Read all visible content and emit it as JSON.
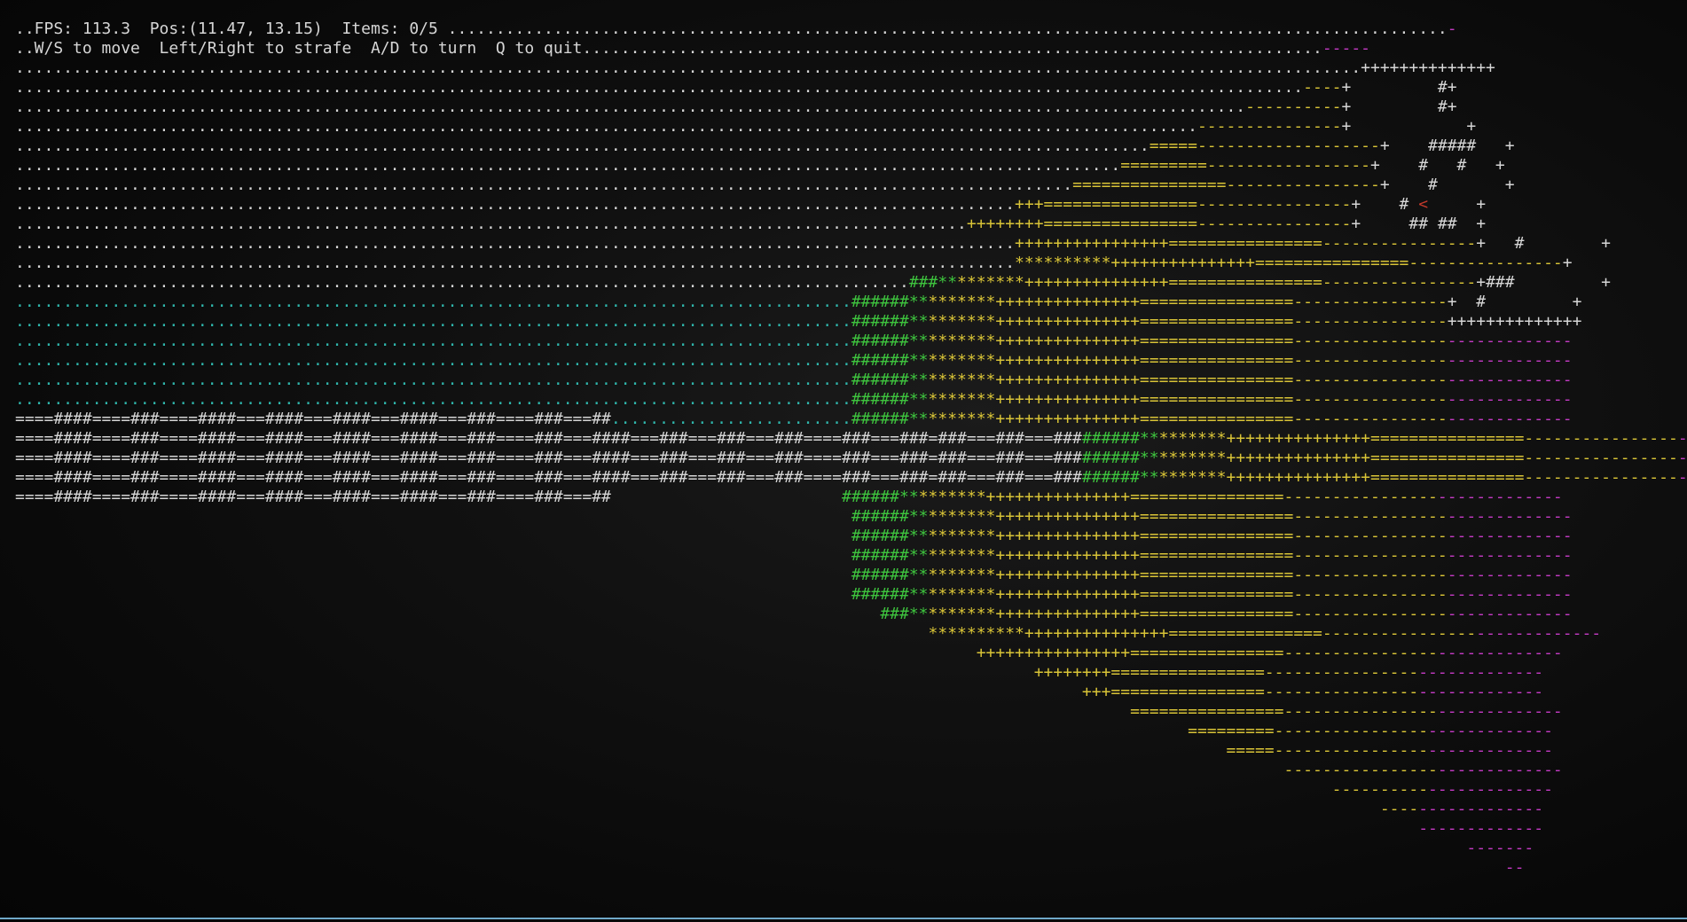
{
  "hud": {
    "status_line": "..FPS: 113.3  Pos:(11.47, 13.15)  Items: 0/5",
    "fps": "113.3",
    "position": "(11.47, 13.15)",
    "items": "0/5",
    "help_line": "..W/S to move  Left/Right to strafe  A/D to turn  Q to quit"
  },
  "palette": {
    "w": "#d6d6d6",
    "c": "#2fb7ad",
    "g": "#3ec43e",
    "y": "#d9c437",
    "m": "#c23ac2",
    "r": "#c0392b"
  },
  "screen_rows": [
    [
      [
        "w",
        "..FPS: 113.3  Pos:(11.47, 13.15)  Items: 0/5 ........................................................................................................"
      ],
      [
        "m",
        "-"
      ]
    ],
    [
      [
        "w",
        "..W/S to move  Left/Right to strafe  A/D to turn  Q to quit............................................................................."
      ],
      [
        "m",
        "-----"
      ]
    ],
    [
      [
        "w",
        "............................................................................................................................................++++++++++++++"
      ]
    ],
    [
      [
        "w",
        "......................................................................................................................................"
      ],
      [
        "y",
        "----"
      ],
      [
        "w",
        "+         #+"
      ]
    ],
    [
      [
        "w",
        "................................................................................................................................"
      ],
      [
        "y",
        "----------"
      ],
      [
        "w",
        "+         #+"
      ]
    ],
    [
      [
        "w",
        "..........................................................................................................................."
      ],
      [
        "y",
        "---------------"
      ],
      [
        "w",
        "+            +"
      ]
    ],
    [
      [
        "w",
        "......................................................................................................................"
      ],
      [
        "y",
        "=====-------------------"
      ],
      [
        "w",
        "+    #####   +"
      ]
    ],
    [
      [
        "w",
        "..................................................................................................................."
      ],
      [
        "y",
        "=========-----------------"
      ],
      [
        "w",
        "+    #   #   +"
      ]
    ],
    [
      [
        "w",
        ".............................................................................................................."
      ],
      [
        "y",
        "================----------------"
      ],
      [
        "w",
        "+    #       +"
      ]
    ],
    [
      [
        "w",
        "........................................................................................................"
      ],
      [
        "y",
        "+++================----------------"
      ],
      [
        "w",
        "+    # "
      ],
      [
        "r",
        "<"
      ],
      [
        "w",
        "     +"
      ]
    ],
    [
      [
        "w",
        "..................................................................................................."
      ],
      [
        "y",
        "++++++++================----------------"
      ],
      [
        "w",
        "+     ## ##  +"
      ]
    ],
    [
      [
        "w",
        "........................................................................................................"
      ],
      [
        "y",
        "++++++++++++++++================----------------"
      ],
      [
        "w",
        "+   #        +"
      ]
    ],
    [
      [
        "w",
        "........................................................................................................"
      ],
      [
        "y",
        "**********+++++++++++++++================----------------"
      ],
      [
        "w",
        "+            +"
      ]
    ],
    [
      [
        "w",
        "............................................................................................."
      ],
      [
        "g",
        "###**"
      ],
      [
        "y",
        "*******+++++++++++++++================----------------"
      ],
      [
        "w",
        "+###         +"
      ]
    ],
    [
      [
        "c",
        "......................................................................................."
      ],
      [
        "g",
        "######**"
      ],
      [
        "y",
        "*******+++++++++++++++================----------------"
      ],
      [
        "w",
        "+  #         +"
      ]
    ],
    [
      [
        "c",
        "......................................................................................."
      ],
      [
        "g",
        "######**"
      ],
      [
        "y",
        "*******+++++++++++++++================----------------"
      ],
      [
        "w",
        "++++++++++++++"
      ]
    ],
    [
      [
        "c",
        "......................................................................................."
      ],
      [
        "g",
        "######**"
      ],
      [
        "y",
        "*******+++++++++++++++================----------------"
      ],
      [
        "m",
        "-------------"
      ]
    ],
    [
      [
        "c",
        "......................................................................................."
      ],
      [
        "g",
        "######**"
      ],
      [
        "y",
        "*******+++++++++++++++================----------------"
      ],
      [
        "m",
        "-------------"
      ]
    ],
    [
      [
        "c",
        "......................................................................................."
      ],
      [
        "g",
        "######**"
      ],
      [
        "y",
        "*******+++++++++++++++================----------------"
      ],
      [
        "m",
        "-------------"
      ]
    ],
    [
      [
        "c",
        "......................................................................................."
      ],
      [
        "g",
        "######**"
      ],
      [
        "y",
        "*******+++++++++++++++================----------------"
      ],
      [
        "m",
        "-------------"
      ]
    ],
    [
      [
        "w",
        "====####====###====####===####===####===####===###====###===##"
      ],
      [
        "c",
        "........................."
      ],
      [
        "g",
        "######**"
      ],
      [
        "y",
        "*******+++++++++++++++================----------------"
      ],
      [
        "m",
        "-------------"
      ]
    ],
    [
      [
        "w",
        "====####====###====####===####===####===####===###====###===####===###===###===###====###===###=###===###===###"
      ],
      [
        "g",
        "######**"
      ],
      [
        "y",
        "*******+++++++++++++++================----------------"
      ],
      [
        "m",
        "-------------"
      ]
    ],
    [
      [
        "w",
        "====####====###====####===####===####===####===###====###===####===###===###===###====###===###=###===###===###"
      ],
      [
        "g",
        "######**"
      ],
      [
        "y",
        "*******+++++++++++++++================----------------"
      ],
      [
        "m",
        "-------------"
      ]
    ],
    [
      [
        "w",
        "====####====###====####===####===####===####===###====###===####===###===###===###====###===###=###===###===###"
      ],
      [
        "g",
        "######**"
      ],
      [
        "y",
        "*******+++++++++++++++================----------------"
      ],
      [
        "m",
        "-------------"
      ]
    ],
    [
      [
        "w",
        "====####====###====####===####===####===####===###====###===##                        "
      ],
      [
        "g",
        "######**"
      ],
      [
        "y",
        "*******+++++++++++++++================----------------"
      ],
      [
        "m",
        "-------------"
      ]
    ],
    [
      [
        "w",
        "                                                                                       "
      ],
      [
        "g",
        "######**"
      ],
      [
        "y",
        "*******+++++++++++++++================----------------"
      ],
      [
        "m",
        "-------------"
      ]
    ],
    [
      [
        "w",
        "                                                                                       "
      ],
      [
        "g",
        "######**"
      ],
      [
        "y",
        "*******+++++++++++++++================----------------"
      ],
      [
        "m",
        "-------------"
      ]
    ],
    [
      [
        "w",
        "                                                                                       "
      ],
      [
        "g",
        "######**"
      ],
      [
        "y",
        "*******+++++++++++++++================----------------"
      ],
      [
        "m",
        "-------------"
      ]
    ],
    [
      [
        "w",
        "                                                                                       "
      ],
      [
        "g",
        "######**"
      ],
      [
        "y",
        "*******+++++++++++++++================----------------"
      ],
      [
        "m",
        "-------------"
      ]
    ],
    [
      [
        "w",
        "                                                                                       "
      ],
      [
        "g",
        "######**"
      ],
      [
        "y",
        "*******+++++++++++++++================----------------"
      ],
      [
        "m",
        "-------------"
      ]
    ],
    [
      [
        "w",
        "                                                                                          "
      ],
      [
        "g",
        "###**"
      ],
      [
        "y",
        "*******+++++++++++++++================----------------"
      ],
      [
        "m",
        "-------------"
      ]
    ],
    [
      [
        "w",
        "                                                                                               "
      ],
      [
        "y",
        "**********+++++++++++++++================----------------"
      ],
      [
        "m",
        "-------------"
      ]
    ],
    [
      [
        "w",
        "                                                                                                    "
      ],
      [
        "y",
        "++++++++++++++++================----------------"
      ],
      [
        "m",
        "-------------"
      ]
    ],
    [
      [
        "w",
        "                                                                                                          "
      ],
      [
        "y",
        "++++++++================----------------"
      ],
      [
        "m",
        "-------------"
      ]
    ],
    [
      [
        "w",
        "                                                                                                               "
      ],
      [
        "y",
        "+++================----------------"
      ],
      [
        "m",
        "-------------"
      ]
    ],
    [
      [
        "w",
        "                                                                                                                    "
      ],
      [
        "y",
        "================----------------"
      ],
      [
        "m",
        "-------------"
      ]
    ],
    [
      [
        "w",
        "                                                                                                                          "
      ],
      [
        "y",
        "=========----------------"
      ],
      [
        "m",
        "-------------"
      ]
    ],
    [
      [
        "w",
        "                                                                                                                              "
      ],
      [
        "y",
        "=====----------------"
      ],
      [
        "m",
        "-------------"
      ]
    ],
    [
      [
        "w",
        "                                                                                                                                    "
      ],
      [
        "y",
        "----------------"
      ],
      [
        "m",
        "-------------"
      ]
    ],
    [
      [
        "w",
        "                                                                                                                                         "
      ],
      [
        "y",
        "----------"
      ],
      [
        "m",
        "-------------"
      ]
    ],
    [
      [
        "w",
        "                                                                                                                                              "
      ],
      [
        "y",
        "----"
      ],
      [
        "m",
        "-------------"
      ]
    ],
    [
      [
        "w",
        "                                                                                                                                                  "
      ],
      [
        "m",
        "-------------"
      ]
    ],
    [
      [
        "w",
        "                                                                                                                                                       "
      ],
      [
        "m",
        "-------"
      ]
    ],
    [
      [
        "w",
        "                                                                                                                                                           "
      ],
      [
        "m",
        "--"
      ]
    ]
  ]
}
